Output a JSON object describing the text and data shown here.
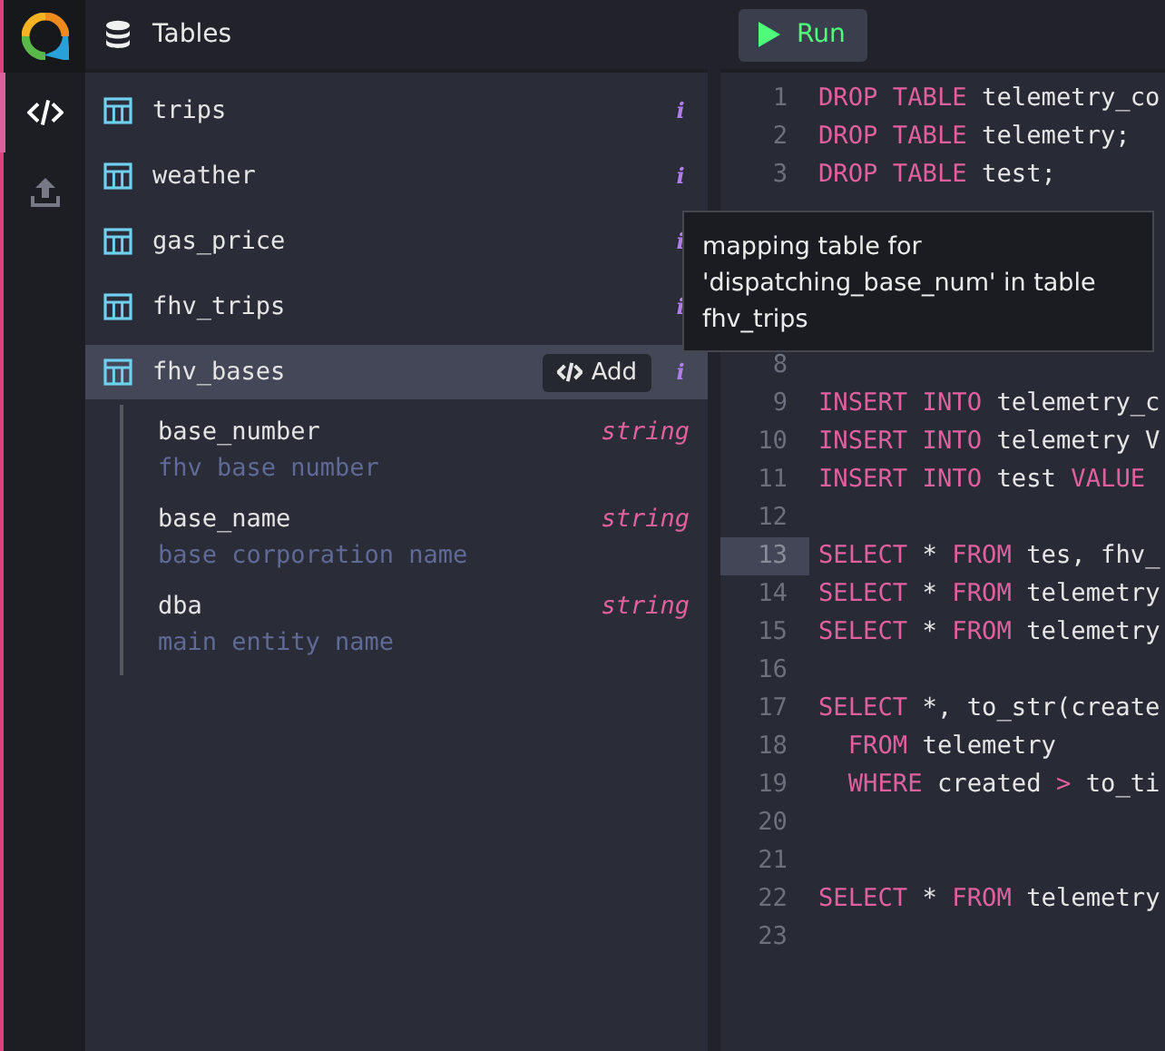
{
  "rail": {
    "items": [
      {
        "kind": "code",
        "selected": true
      },
      {
        "kind": "upload",
        "selected": false
      }
    ]
  },
  "header": {
    "title": "Tables"
  },
  "tables": [
    {
      "name": "trips",
      "selected": false,
      "info": "i"
    },
    {
      "name": "weather",
      "selected": false,
      "info": "i"
    },
    {
      "name": "gas_price",
      "selected": false,
      "info": "i"
    },
    {
      "name": "fhv_trips",
      "selected": false,
      "info": "i"
    },
    {
      "name": "fhv_bases",
      "selected": true,
      "info": "i",
      "add_label": "Add",
      "expanded": true,
      "fields": [
        {
          "name": "base_number",
          "type": "string",
          "description": "fhv base number"
        },
        {
          "name": "base_name",
          "type": "string",
          "description": "base corporation name"
        },
        {
          "name": "dba",
          "type": "string",
          "description": "main entity name"
        }
      ]
    }
  ],
  "run_button": {
    "label": "Run"
  },
  "editor": {
    "lines": [
      {
        "kind": "code",
        "number": "1",
        "current": false,
        "tokens": [
          {
            "kind": "keyword",
            "text": "DROP TABLE"
          },
          {
            "kind": "plain",
            "text": " telemetry_co"
          }
        ]
      },
      {
        "kind": "code",
        "number": "2",
        "current": false,
        "tokens": [
          {
            "kind": "keyword",
            "text": "DROP TABLE"
          },
          {
            "kind": "plain",
            "text": " telemetry;"
          }
        ]
      },
      {
        "kind": "code",
        "number": "3",
        "current": false,
        "tokens": [
          {
            "kind": "keyword",
            "text": "DROP TABLE"
          },
          {
            "kind": "plain",
            "text": " test;"
          }
        ]
      },
      {
        "kind": "covered"
      },
      {
        "kind": "covered"
      },
      {
        "kind": "covered"
      },
      {
        "kind": "covered"
      },
      {
        "kind": "code",
        "number": "8",
        "current": false
      },
      {
        "kind": "code",
        "number": "9",
        "current": false,
        "tokens": [
          {
            "kind": "keyword",
            "text": "INSERT INTO"
          },
          {
            "kind": "plain",
            "text": " telemetry_c"
          }
        ]
      },
      {
        "kind": "code",
        "number": "10",
        "current": false,
        "tokens": [
          {
            "kind": "keyword",
            "text": "INSERT INTO"
          },
          {
            "kind": "plain",
            "text": " telemetry V"
          }
        ]
      },
      {
        "kind": "code",
        "number": "11",
        "current": false,
        "tokens": [
          {
            "kind": "keyword",
            "text": "INSERT INTO"
          },
          {
            "kind": "plain",
            "text": " test "
          },
          {
            "kind": "keyword",
            "text": "VALUE"
          }
        ]
      },
      {
        "kind": "code",
        "number": "12",
        "current": false
      },
      {
        "kind": "code",
        "number": "13",
        "current": true,
        "tokens": [
          {
            "kind": "keyword",
            "text": "SELECT"
          },
          {
            "kind": "plain",
            "text": " * "
          },
          {
            "kind": "keyword",
            "text": "FROM"
          },
          {
            "kind": "plain",
            "text": " tes, fhv_"
          }
        ]
      },
      {
        "kind": "code",
        "number": "14",
        "current": false,
        "tokens": [
          {
            "kind": "keyword",
            "text": "SELECT"
          },
          {
            "kind": "plain",
            "text": " * "
          },
          {
            "kind": "keyword",
            "text": "FROM"
          },
          {
            "kind": "plain",
            "text": " telemetry"
          }
        ]
      },
      {
        "kind": "code",
        "number": "15",
        "current": false,
        "tokens": [
          {
            "kind": "keyword",
            "text": "SELECT"
          },
          {
            "kind": "plain",
            "text": " * "
          },
          {
            "kind": "keyword",
            "text": "FROM"
          },
          {
            "kind": "plain",
            "text": " telemetry"
          }
        ]
      },
      {
        "kind": "code",
        "number": "16",
        "current": false
      },
      {
        "kind": "code",
        "number": "17",
        "current": false,
        "tokens": [
          {
            "kind": "keyword",
            "text": "SELECT"
          },
          {
            "kind": "plain",
            "text": " *, to_str(create"
          }
        ]
      },
      {
        "kind": "indented",
        "number": "18",
        "current": false,
        "tokens": [
          {
            "kind": "keyword",
            "text": "FROM"
          },
          {
            "kind": "plain",
            "text": " telemetry"
          }
        ]
      },
      {
        "kind": "indented",
        "number": "19",
        "current": false,
        "tokens": [
          {
            "kind": "keyword",
            "text": "WHERE"
          },
          {
            "kind": "plain",
            "text": " created "
          },
          {
            "kind": "keyword",
            "text": ">"
          },
          {
            "kind": "plain",
            "text": " to_ti"
          }
        ]
      },
      {
        "kind": "code",
        "number": "20",
        "current": false
      },
      {
        "kind": "code",
        "number": "21",
        "current": false
      },
      {
        "kind": "code",
        "number": "22",
        "current": false,
        "tokens": [
          {
            "kind": "keyword",
            "text": "SELECT"
          },
          {
            "kind": "plain",
            "text": " * "
          },
          {
            "kind": "keyword",
            "text": "FROM"
          },
          {
            "kind": "plain",
            "text": " telemetry"
          }
        ]
      },
      {
        "kind": "code",
        "number": "23",
        "current": false
      }
    ]
  },
  "tooltip": {
    "text": "mapping table for 'dispatching_base_num' in table fhv_trips"
  }
}
